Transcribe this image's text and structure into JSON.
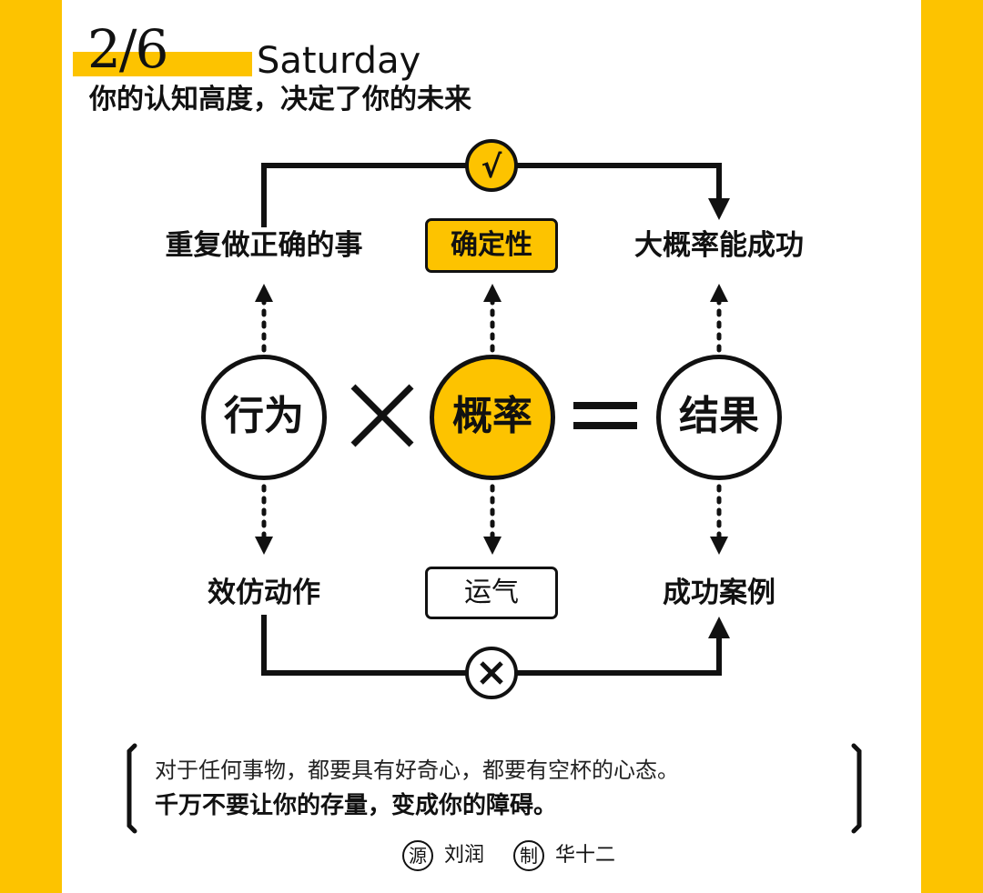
{
  "header": {
    "date": "2/6",
    "weekday": "Saturday",
    "subtitle": "你的认知高度，决定了你的未来"
  },
  "diagram": {
    "top_left_label": "重复做正确的事",
    "top_center_box": "确定性",
    "top_right_label": "大概率能成功",
    "circle_left": "行为",
    "circle_center": "概率",
    "circle_right": "结果",
    "bottom_left_label": "效仿动作",
    "bottom_center_box": "运气",
    "bottom_right_label": "成功案例",
    "top_mark": "√",
    "bottom_mark": "×",
    "operator_multiply": "×",
    "operator_equals": "="
  },
  "quote": {
    "line1": "对于任何事物，都要具有好奇心，都要有空杯的心态。",
    "line2": "千万不要让你的存量，变成你的障碍。"
  },
  "credits": {
    "source_badge": "源",
    "source_name": "刘润",
    "maker_badge": "制",
    "maker_name": "华十二"
  },
  "colors": {
    "accent": "#fdc300",
    "ink": "#111111",
    "background": "#ffffff"
  }
}
